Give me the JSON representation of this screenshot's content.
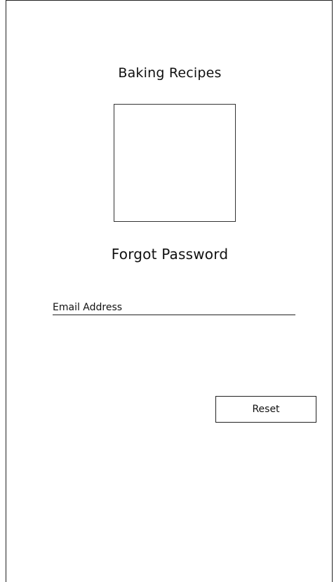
{
  "app": {
    "title": "Baking Recipes"
  },
  "page": {
    "title": "Forgot Password"
  },
  "form": {
    "email_placeholder": "Email Address",
    "email_value": "",
    "reset_label": "Reset"
  }
}
